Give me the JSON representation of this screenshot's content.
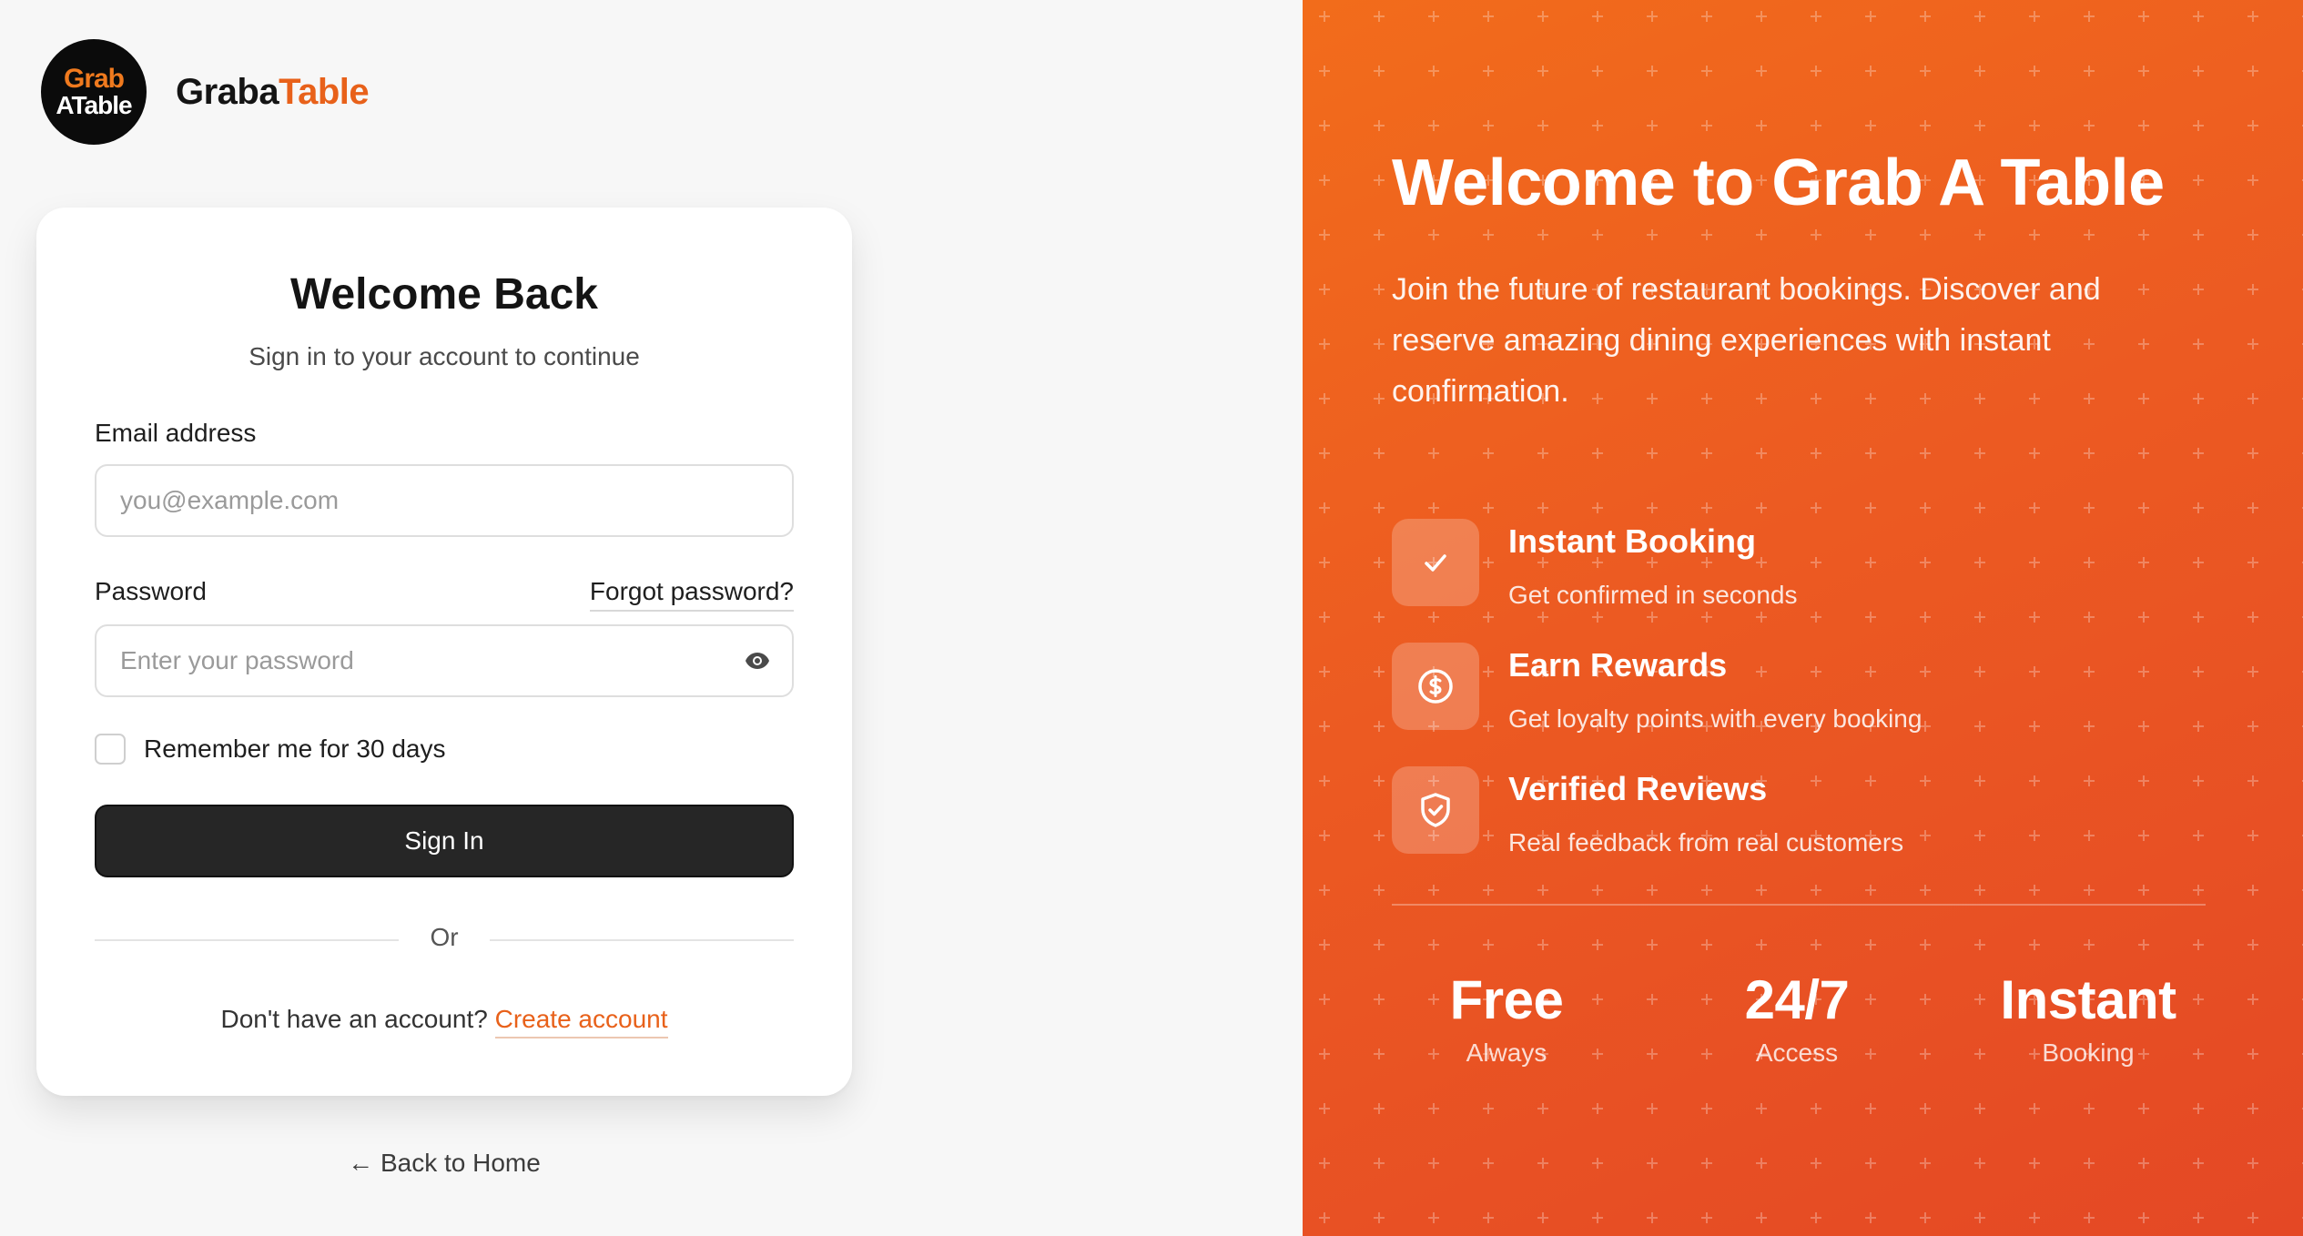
{
  "brand": {
    "logo_line1": "Grab",
    "logo_line2": "ATable",
    "name_part1": "Graba",
    "name_part2": "Table"
  },
  "login": {
    "title": "Welcome Back",
    "subtitle": "Sign in to your account to continue",
    "email_label": "Email address",
    "email_placeholder": "you@example.com",
    "email_value": "",
    "password_label": "Password",
    "forgot_label": "Forgot password?",
    "password_placeholder": "Enter your password",
    "password_value": "",
    "remember_label": "Remember me for 30 days",
    "remember_checked": false,
    "signin_label": "Sign In",
    "or_label": "Or",
    "no_account_text": "Don't have an account?",
    "create_account_label": "Create account",
    "back_label": "← Back to Home"
  },
  "promo": {
    "title": "Welcome to Grab A Table",
    "description": "Join the future of restaurant bookings. Discover and reserve amazing dining experiences with instant confirmation.",
    "features": [
      {
        "icon": "check-icon",
        "title": "Instant Booking",
        "subtitle": "Get confirmed in seconds"
      },
      {
        "icon": "dollar-coin-icon",
        "title": "Earn Rewards",
        "subtitle": "Get loyalty points with every booking"
      },
      {
        "icon": "shield-check-icon",
        "title": "Verified Reviews",
        "subtitle": "Real feedback from real customers"
      }
    ],
    "stats": [
      {
        "value": "Free",
        "label": "Always"
      },
      {
        "value": "24/7",
        "label": "Access"
      },
      {
        "value": "Instant",
        "label": "Booking"
      }
    ]
  },
  "colors": {
    "accent": "#e8611a",
    "panel_gradient_start": "#f26c1b",
    "panel_gradient_end": "#e44825",
    "button_dark": "#262626"
  }
}
